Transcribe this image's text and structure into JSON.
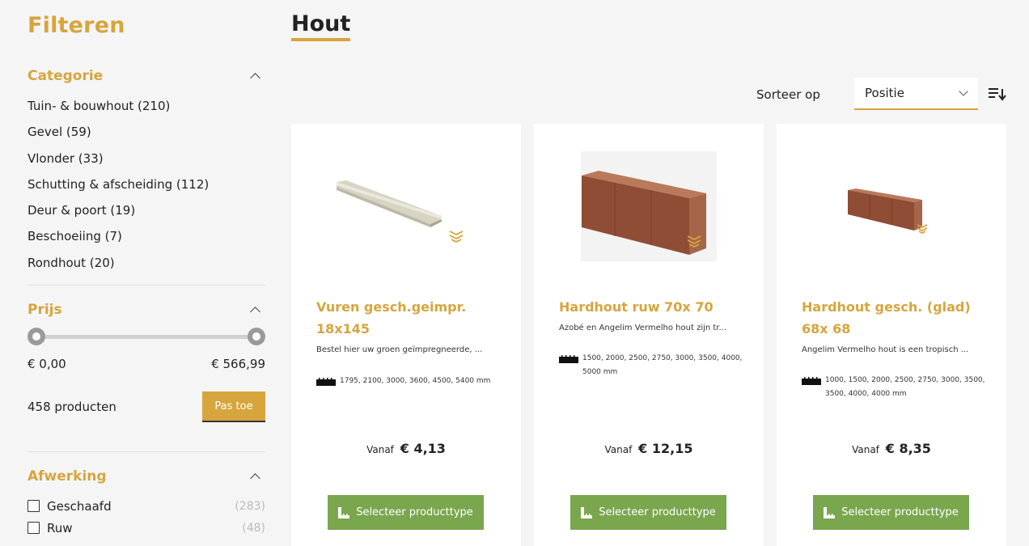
{
  "sidebar": {
    "title": "Filteren",
    "categorie": {
      "title": "Categorie",
      "items": [
        "Tuin- & bouwhout (210)",
        "Gevel (59)",
        "Vlonder (33)",
        "Schutting & afscheiding (112)",
        "Deur & poort (19)",
        "Beschoeiing (7)",
        "Rondhout (20)"
      ]
    },
    "prijs": {
      "title": "Prijs",
      "min_label": "€ 0,00",
      "max_label": "€ 566,99",
      "slider_min_fraction": 0,
      "slider_max_fraction": 1,
      "count": "458 producten",
      "apply_label": "Pas toe"
    },
    "afwerking": {
      "title": "Afwerking",
      "items": [
        {
          "label": "Geschaafd",
          "count": "(283)"
        },
        {
          "label": "Ruw",
          "count": "(48)"
        }
      ]
    }
  },
  "main": {
    "title": "Hout",
    "sort": {
      "label": "Sorteer op",
      "value": "Positie"
    },
    "products": [
      {
        "name": "Vuren gesch.geimpr. 18x145",
        "description": "Bestel hier uw groen geïmpregneerde, ...",
        "lengths": "1795, 2100, 3000, 3600, 4500, 5400 mm",
        "price_prefix": "Vanaf",
        "price": "€ 4,13",
        "button": "Selecteer producttype"
      },
      {
        "name": "Hardhout ruw 70x 70",
        "description": "Azobé en Angelim Vermelho hout zijn tr...",
        "lengths": "1500, 2000, 2500, 2750, 3000, 3500, 4000, 5000 mm",
        "price_prefix": "Vanaf",
        "price": "€ 12,15",
        "button": "Selecteer producttype"
      },
      {
        "name": "Hardhout gesch. (glad) 68x 68",
        "description": "Angelim Vermelho hout is een tropisch ...",
        "lengths": "1000, 1500, 2000, 2500, 2750, 3000, 3500, 3500, 4000, 4000 mm",
        "price_prefix": "Vanaf",
        "price": "€ 8,35",
        "button": "Selecteer producttype"
      }
    ]
  },
  "colors": {
    "accent": "#d6a53d",
    "button_green": "#7aa64e",
    "background": "#f5f5f5"
  },
  "icons": [
    "chevron-up-icon",
    "chevron-down-icon",
    "sort-direction-icon",
    "ruler-icon",
    "product-type-icon",
    "brand-mark-icon"
  ]
}
